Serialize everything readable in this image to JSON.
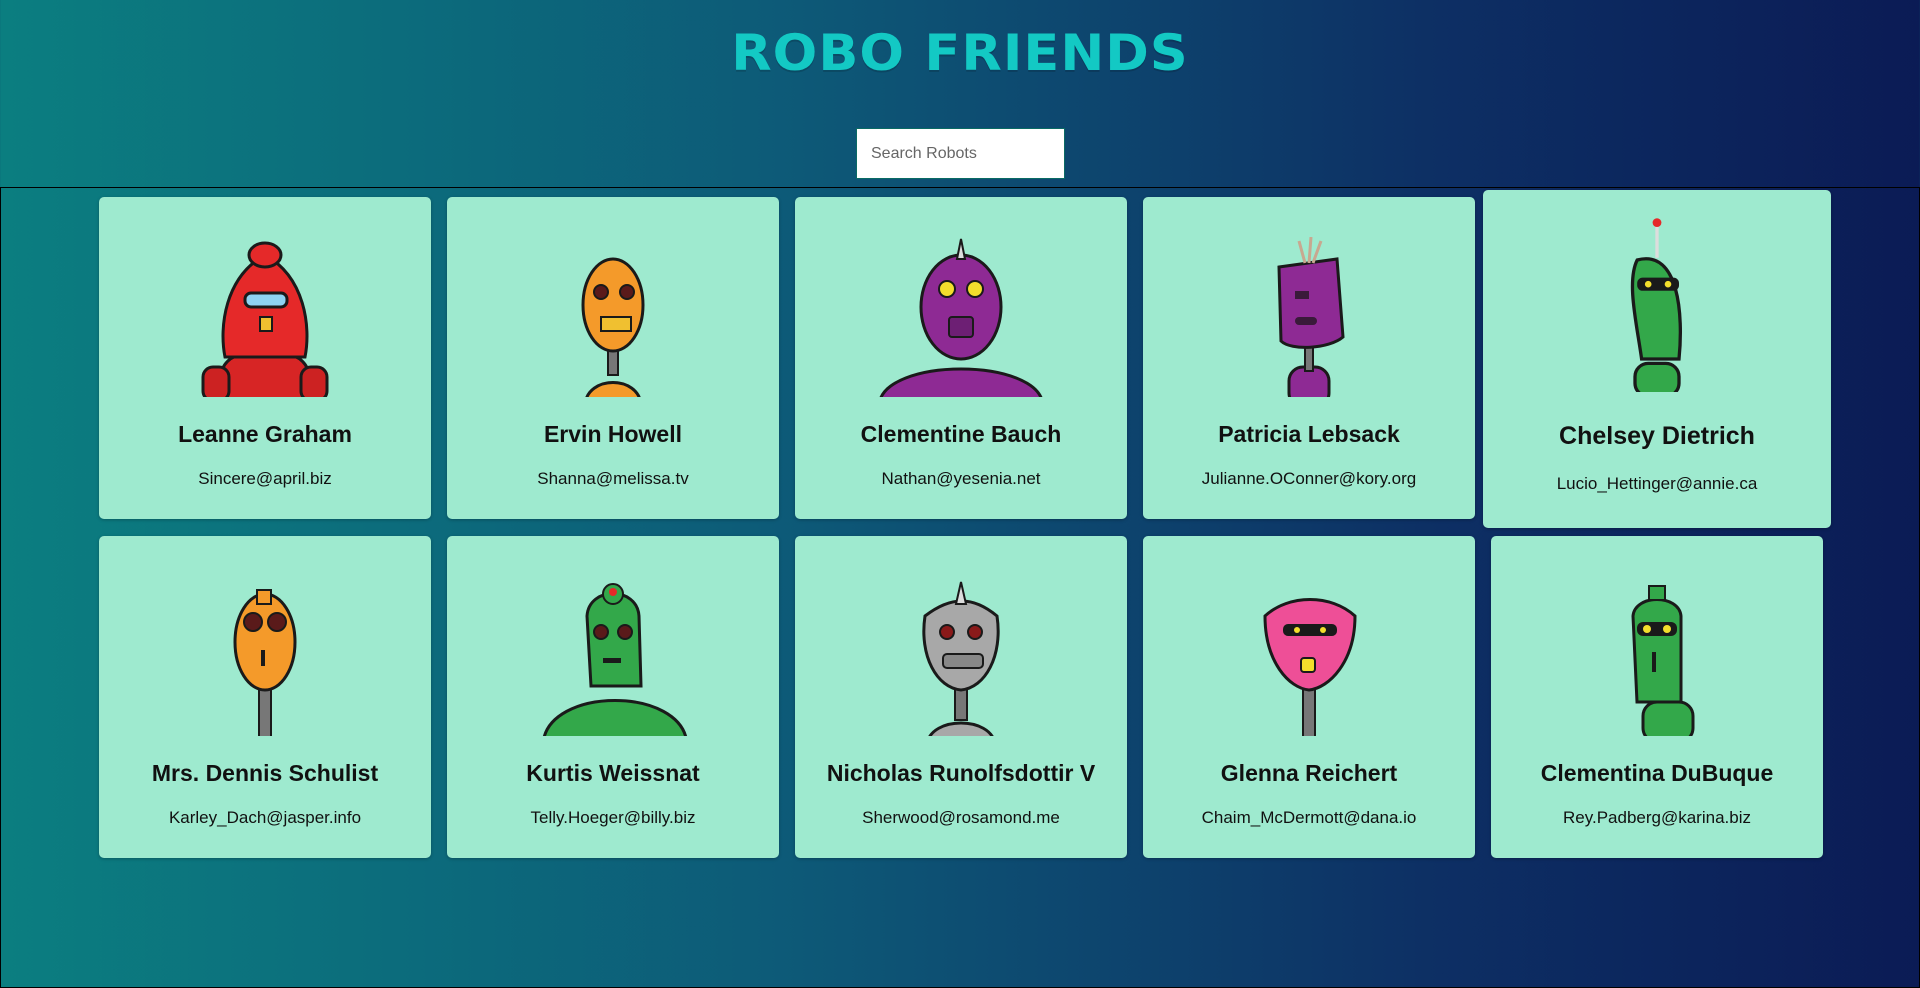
{
  "app": {
    "title": "ROBO FRIENDS"
  },
  "search": {
    "placeholder": "Search Robots",
    "value": ""
  },
  "colors": {
    "card_bg": "#9eeacf",
    "title": "#13c9c4"
  },
  "robots": [
    {
      "name": "Leanne Graham",
      "email": "Sincere@april.biz",
      "color": "#e52929"
    },
    {
      "name": "Ervin Howell",
      "email": "Shanna@melissa.tv",
      "color": "#f49a2a"
    },
    {
      "name": "Clementine Bauch",
      "email": "Nathan@yesenia.net",
      "color": "#8e2a94"
    },
    {
      "name": "Patricia Lebsack",
      "email": "Julianne.OConner@kory.org",
      "color": "#8e2a94"
    },
    {
      "name": "Chelsey Dietrich",
      "email": "Lucio_Hettinger@annie.ca",
      "color": "#33a84a"
    },
    {
      "name": "Mrs. Dennis Schulist",
      "email": "Karley_Dach@jasper.info",
      "color": "#f49a2a"
    },
    {
      "name": "Kurtis Weissnat",
      "email": "Telly.Hoeger@billy.biz",
      "color": "#33a84a"
    },
    {
      "name": "Nicholas Runolfsdottir V",
      "email": "Sherwood@rosamond.me",
      "color": "#a8a8a8"
    },
    {
      "name": "Glenna Reichert",
      "email": "Chaim_McDermott@dana.io",
      "color": "#ee4f97"
    },
    {
      "name": "Clementina DuBuque",
      "email": "Rey.Padberg@karina.biz",
      "color": "#33a84a"
    }
  ]
}
